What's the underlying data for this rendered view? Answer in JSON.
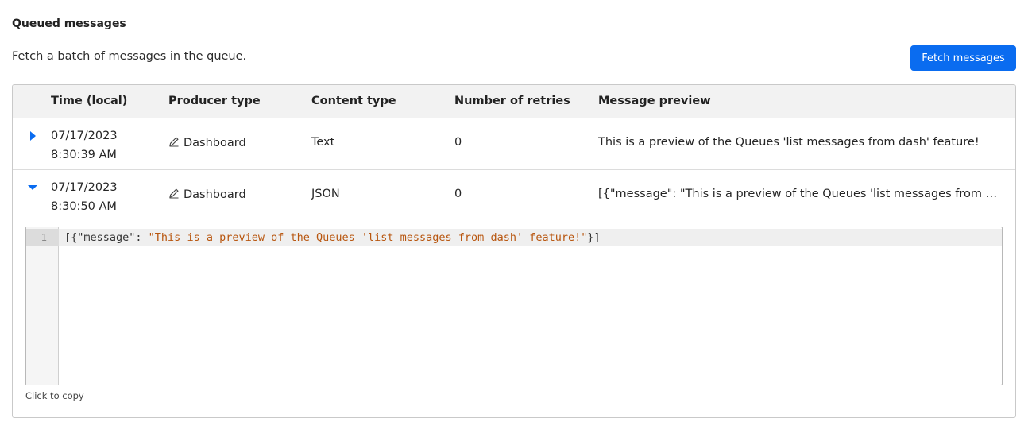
{
  "header": {
    "title": "Queued messages",
    "subtitle": "Fetch a batch of messages in the queue.",
    "fetch_label": "Fetch messages"
  },
  "table": {
    "columns": [
      "Time (local)",
      "Producer type",
      "Content type",
      "Number of retries",
      "Message preview"
    ],
    "rows": [
      {
        "date": "07/17/2023",
        "time": "8:30:39 AM",
        "producer": "Dashboard",
        "content_type": "Text",
        "retries": "0",
        "preview": "This is a preview of the Queues 'list messages from dash' feature!",
        "expanded": false
      },
      {
        "date": "07/17/2023",
        "time": "8:30:50 AM",
        "producer": "Dashboard",
        "content_type": "JSON",
        "retries": "0",
        "preview": "[{\"message\": \"This is a preview of the Queues 'list messages from dash' feature!\"}]",
        "expanded": true
      }
    ]
  },
  "editor": {
    "line_number": "1",
    "code_open": "[{\"message\": ",
    "code_string": "\"This is a preview of the Queues 'list messages from dash' feature!\"",
    "code_close": "}]",
    "copy_hint": "Click to copy"
  },
  "colors": {
    "accent": "#0a6cf0",
    "string": "#b8560f"
  },
  "icons": {
    "collapsed": "caret-right-icon",
    "expanded": "caret-down-icon",
    "producer": "pencil-icon"
  }
}
